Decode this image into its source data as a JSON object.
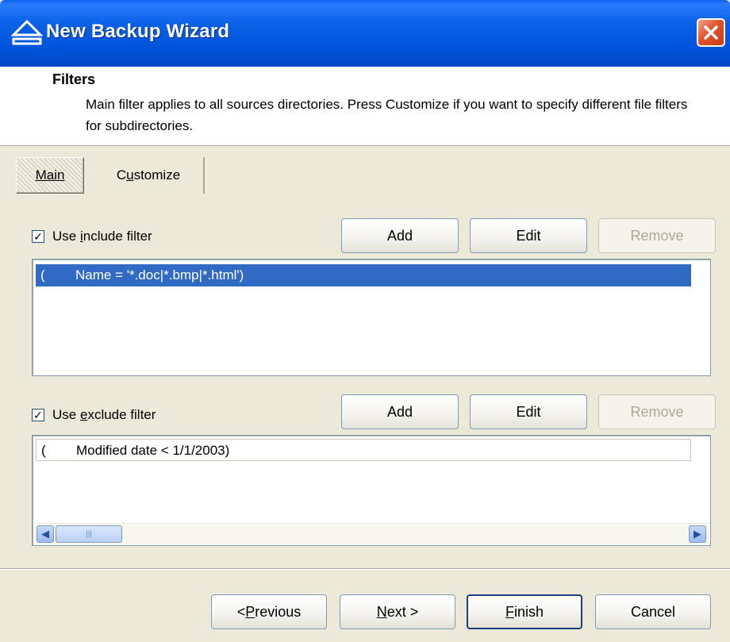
{
  "window": {
    "title": "New Backup Wizard",
    "accent_color": "#0054dc",
    "title_icon": "eject-icon",
    "close_icon": "close-icon"
  },
  "header": {
    "title": "Filters",
    "description": "Main filter applies to all sources directories. Press Customize if you want to specify different file filters for subdirectories."
  },
  "tabs": [
    {
      "label_pre": "",
      "label_accel": "M",
      "label_post": "ain",
      "selected": true
    },
    {
      "label_pre": "C",
      "label_accel": "u",
      "label_post": "stomize",
      "selected": false
    }
  ],
  "include_filter": {
    "label_pre": "Use ",
    "label_accel": "i",
    "label_post": "nclude filter",
    "checked": true,
    "buttons": {
      "add": "Add",
      "edit": "Edit",
      "remove": "Remove"
    },
    "items": [
      {
        "paren": "(",
        "condition": "Name = '*.doc|*.bmp|*.html')",
        "selected": true
      }
    ]
  },
  "exclude_filter": {
    "label_pre": "Use ",
    "label_accel": "e",
    "label_post": "xclude filter",
    "checked": true,
    "buttons": {
      "add": "Add",
      "edit": "Edit",
      "remove": "Remove"
    },
    "items": [
      {
        "paren": "(",
        "condition": "Modified date < 1/1/2003)",
        "selected": false
      }
    ]
  },
  "footer": {
    "previous_pre": "< ",
    "previous_accel": "P",
    "previous_post": "revious",
    "next_accel": "N",
    "next_post": "ext >",
    "finish_accel": "F",
    "finish_post": "inish",
    "cancel": "Cancel"
  },
  "colors": {
    "selection": "#316ac5",
    "dialog_bg": "#ece9d8",
    "close_button": "#e0532b"
  }
}
